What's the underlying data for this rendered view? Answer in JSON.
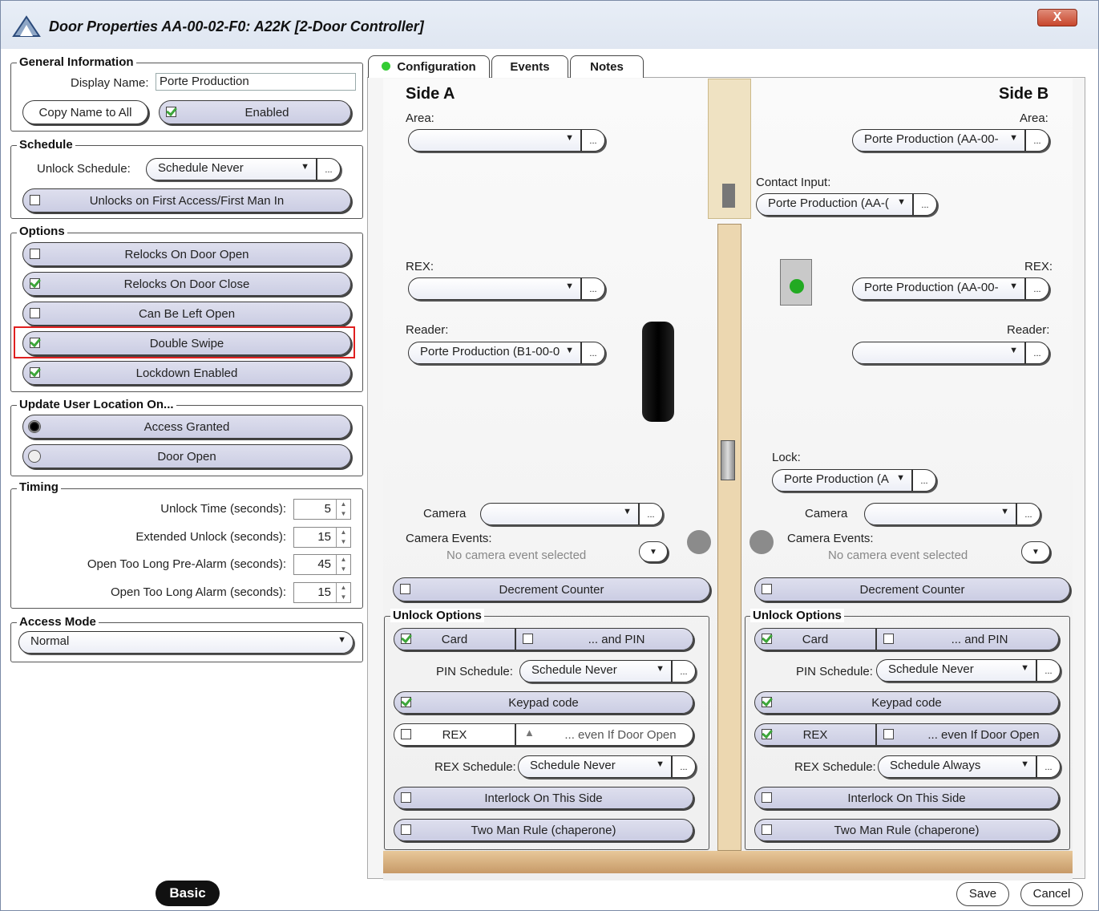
{
  "window": {
    "title": "Door Properties  AA-00-02-F0: A22K [2-Door Controller]",
    "close": "X"
  },
  "general": {
    "legend": "General Information",
    "display_name_label": "Display Name:",
    "display_name_value": "Porte Production",
    "copy_name_button": "Copy Name to All",
    "enabled_label": "Enabled",
    "enabled": true
  },
  "schedule": {
    "legend": "Schedule",
    "unlock_label": "Unlock Schedule:",
    "unlock_value": "Schedule Never",
    "first_access_label": "Unlocks on First Access/First Man In",
    "first_access": false
  },
  "options": {
    "legend": "Options",
    "items": [
      {
        "label": "Relocks On Door Open",
        "checked": false
      },
      {
        "label": "Relocks On Door Close",
        "checked": true
      },
      {
        "label": "Can Be Left Open",
        "checked": false
      },
      {
        "label": "Double Swipe",
        "checked": true
      },
      {
        "label": "Lockdown Enabled",
        "checked": true
      }
    ]
  },
  "update_location": {
    "legend": "Update User Location On...",
    "items": [
      {
        "label": "Access Granted",
        "selected": true
      },
      {
        "label": "Door Open",
        "selected": false
      }
    ]
  },
  "timing": {
    "legend": "Timing",
    "rows": [
      {
        "label": "Unlock Time (seconds):",
        "value": "5"
      },
      {
        "label": "Extended Unlock (seconds):",
        "value": "15"
      },
      {
        "label": "Open Too Long Pre-Alarm (seconds):",
        "value": "45"
      },
      {
        "label": "Open Too Long Alarm (seconds):",
        "value": "15"
      }
    ]
  },
  "access_mode": {
    "legend": "Access Mode",
    "value": "Normal"
  },
  "tabs": [
    {
      "label": "Configuration",
      "active": true
    },
    {
      "label": "Events",
      "active": false
    },
    {
      "label": "Notes",
      "active": false
    }
  ],
  "side_a": {
    "title": "Side A",
    "area_label": "Area:",
    "area_value": "",
    "rex_label": "REX:",
    "rex_value": "",
    "reader_label": "Reader:",
    "reader_value": "Porte Production (B1-00-0",
    "camera_label": "Camera",
    "camera_value": "",
    "camera_events_label": "Camera Events:",
    "camera_events_value": "No camera event selected",
    "decrement_label": "Decrement Counter",
    "unlock_options_legend": "Unlock Options",
    "card_label": "Card",
    "card_checked": true,
    "and_pin_label": "... and PIN",
    "and_pin_checked": false,
    "pin_schedule_label": "PIN Schedule:",
    "pin_schedule_value": "Schedule Never",
    "keypad_label": "Keypad code",
    "keypad_checked": true,
    "rex_opt_label": "REX",
    "rex_opt_checked": false,
    "even_open_label": "... even If Door Open",
    "rex_schedule_label": "REX Schedule:",
    "rex_schedule_value": "Schedule Never",
    "interlock_label": "Interlock On This Side",
    "two_man_label": "Two Man Rule (chaperone)"
  },
  "side_b": {
    "title": "Side B",
    "area_label": "Area:",
    "area_value": "Porte Production (AA-00-",
    "contact_label": "Contact Input:",
    "contact_value": "Porte Production (AA-(",
    "rex_label": "REX:",
    "rex_value": "Porte Production (AA-00-",
    "reader_label": "Reader:",
    "reader_value": "",
    "lock_label": "Lock:",
    "lock_value": "Porte Production (A",
    "camera_label": "Camera",
    "camera_value": "",
    "camera_events_label": "Camera Events:",
    "camera_events_value": "No camera event selected",
    "decrement_label": "Decrement Counter",
    "unlock_options_legend": "Unlock Options",
    "card_label": "Card",
    "card_checked": true,
    "and_pin_label": "... and PIN",
    "and_pin_checked": false,
    "pin_schedule_label": "PIN Schedule:",
    "pin_schedule_value": "Schedule Never",
    "keypad_label": "Keypad code",
    "keypad_checked": true,
    "rex_opt_label": "REX",
    "rex_opt_checked": true,
    "even_open_label": "... even If Door Open",
    "even_open_checked": false,
    "rex_schedule_label": "REX Schedule:",
    "rex_schedule_value": "Schedule Always",
    "interlock_label": "Interlock On This Side",
    "two_man_label": "Two Man Rule (chaperone)"
  },
  "footer": {
    "basic": "Basic",
    "save": "Save",
    "cancel": "Cancel"
  },
  "misc": {
    "ellipsis": "...",
    "arrow": "▼"
  },
  "colors": {
    "accent": "#cbcde3",
    "highlight": "#e02020",
    "check": "#3da63a"
  }
}
